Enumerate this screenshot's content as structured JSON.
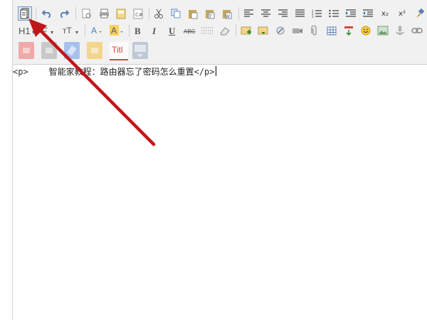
{
  "toolbar": {
    "heading_label": "H1",
    "font_label": "F",
    "size_label": "тT",
    "bold": "B",
    "italic": "I",
    "underline": "U",
    "strike": "ABC",
    "subscript": "x₂",
    "superscript": "x²",
    "title_label": "Titl"
  },
  "editor": {
    "open_tag": "<p>",
    "text": "    智能家教程：路由器忘了密码怎么重置",
    "close_tag": "</p>"
  },
  "colors": {
    "arrow": "#c0161a",
    "toolbar_bg": "#f1f1f1",
    "accent_blue": "#4a7cc2"
  }
}
